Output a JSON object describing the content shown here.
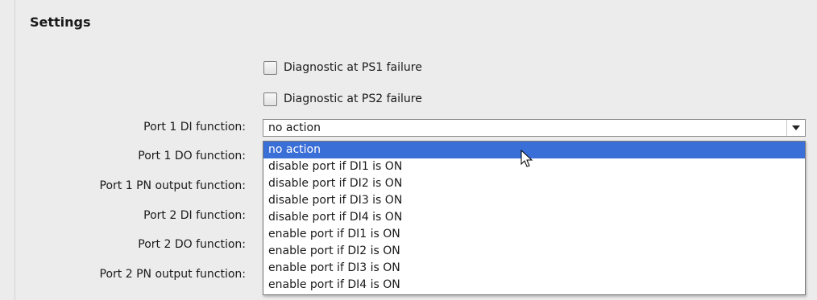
{
  "section": {
    "title": "Settings"
  },
  "checkboxes": [
    {
      "label": "Diagnostic at PS1 failure",
      "checked": false
    },
    {
      "label": "Diagnostic at PS2 failure",
      "checked": false
    }
  ],
  "fields": [
    {
      "label": "Port 1 DI function:"
    },
    {
      "label": "Port 1 DO function:"
    },
    {
      "label": "Port 1 PN output function:"
    },
    {
      "label": "Port 2 DI function:"
    },
    {
      "label": "Port 2 DO function:"
    },
    {
      "label": "Port 2 PN output function:"
    }
  ],
  "combo": {
    "value": "no action",
    "arrow_icon": "chevron-down-icon"
  },
  "dropdown": {
    "selected_index": 0,
    "options": [
      "no action",
      "disable port if DI1 is ON",
      "disable port if DI2 is ON",
      "disable port if DI3 is ON",
      "disable port if DI4 is ON",
      "enable port if DI1 is ON",
      "enable port if DI2 is ON",
      "enable port if DI3 is ON",
      "enable port if DI4 is ON"
    ]
  },
  "colors": {
    "highlight": "#3a6fd8",
    "background": "#ececec"
  }
}
